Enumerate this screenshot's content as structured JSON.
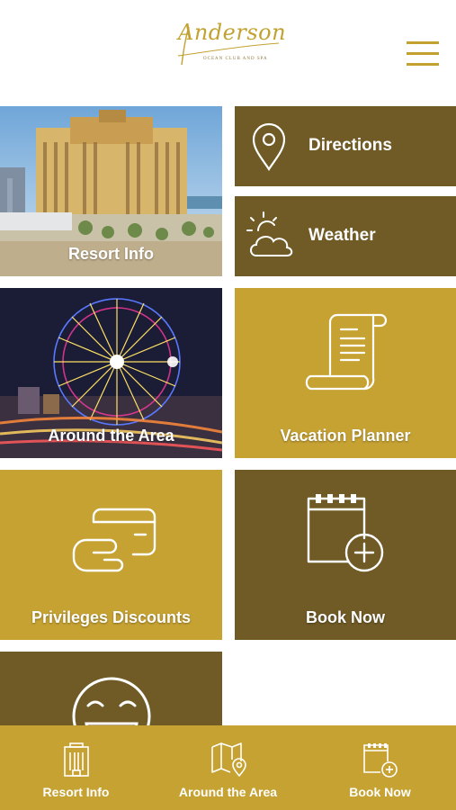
{
  "header": {
    "logo_text": "Anderson",
    "logo_subtitle": "OCEAN CLUB AND SPA"
  },
  "tiles": {
    "resort_info": "Resort Info",
    "directions": "Directions",
    "weather": "Weather",
    "around_area": "Around the Area",
    "vacation_planner": "Vacation Planner",
    "privileges": "Privileges Discounts",
    "book_now": "Book Now"
  },
  "tabbar": {
    "items": [
      {
        "label": "Resort Info",
        "icon": "building-icon"
      },
      {
        "label": "Around the Area",
        "icon": "map-pin-icon"
      },
      {
        "label": "Book Now",
        "icon": "calendar-plus-icon"
      }
    ]
  },
  "colors": {
    "gold": "#c6a233",
    "brown": "#705b26",
    "logo_gold": "#c3a131"
  }
}
